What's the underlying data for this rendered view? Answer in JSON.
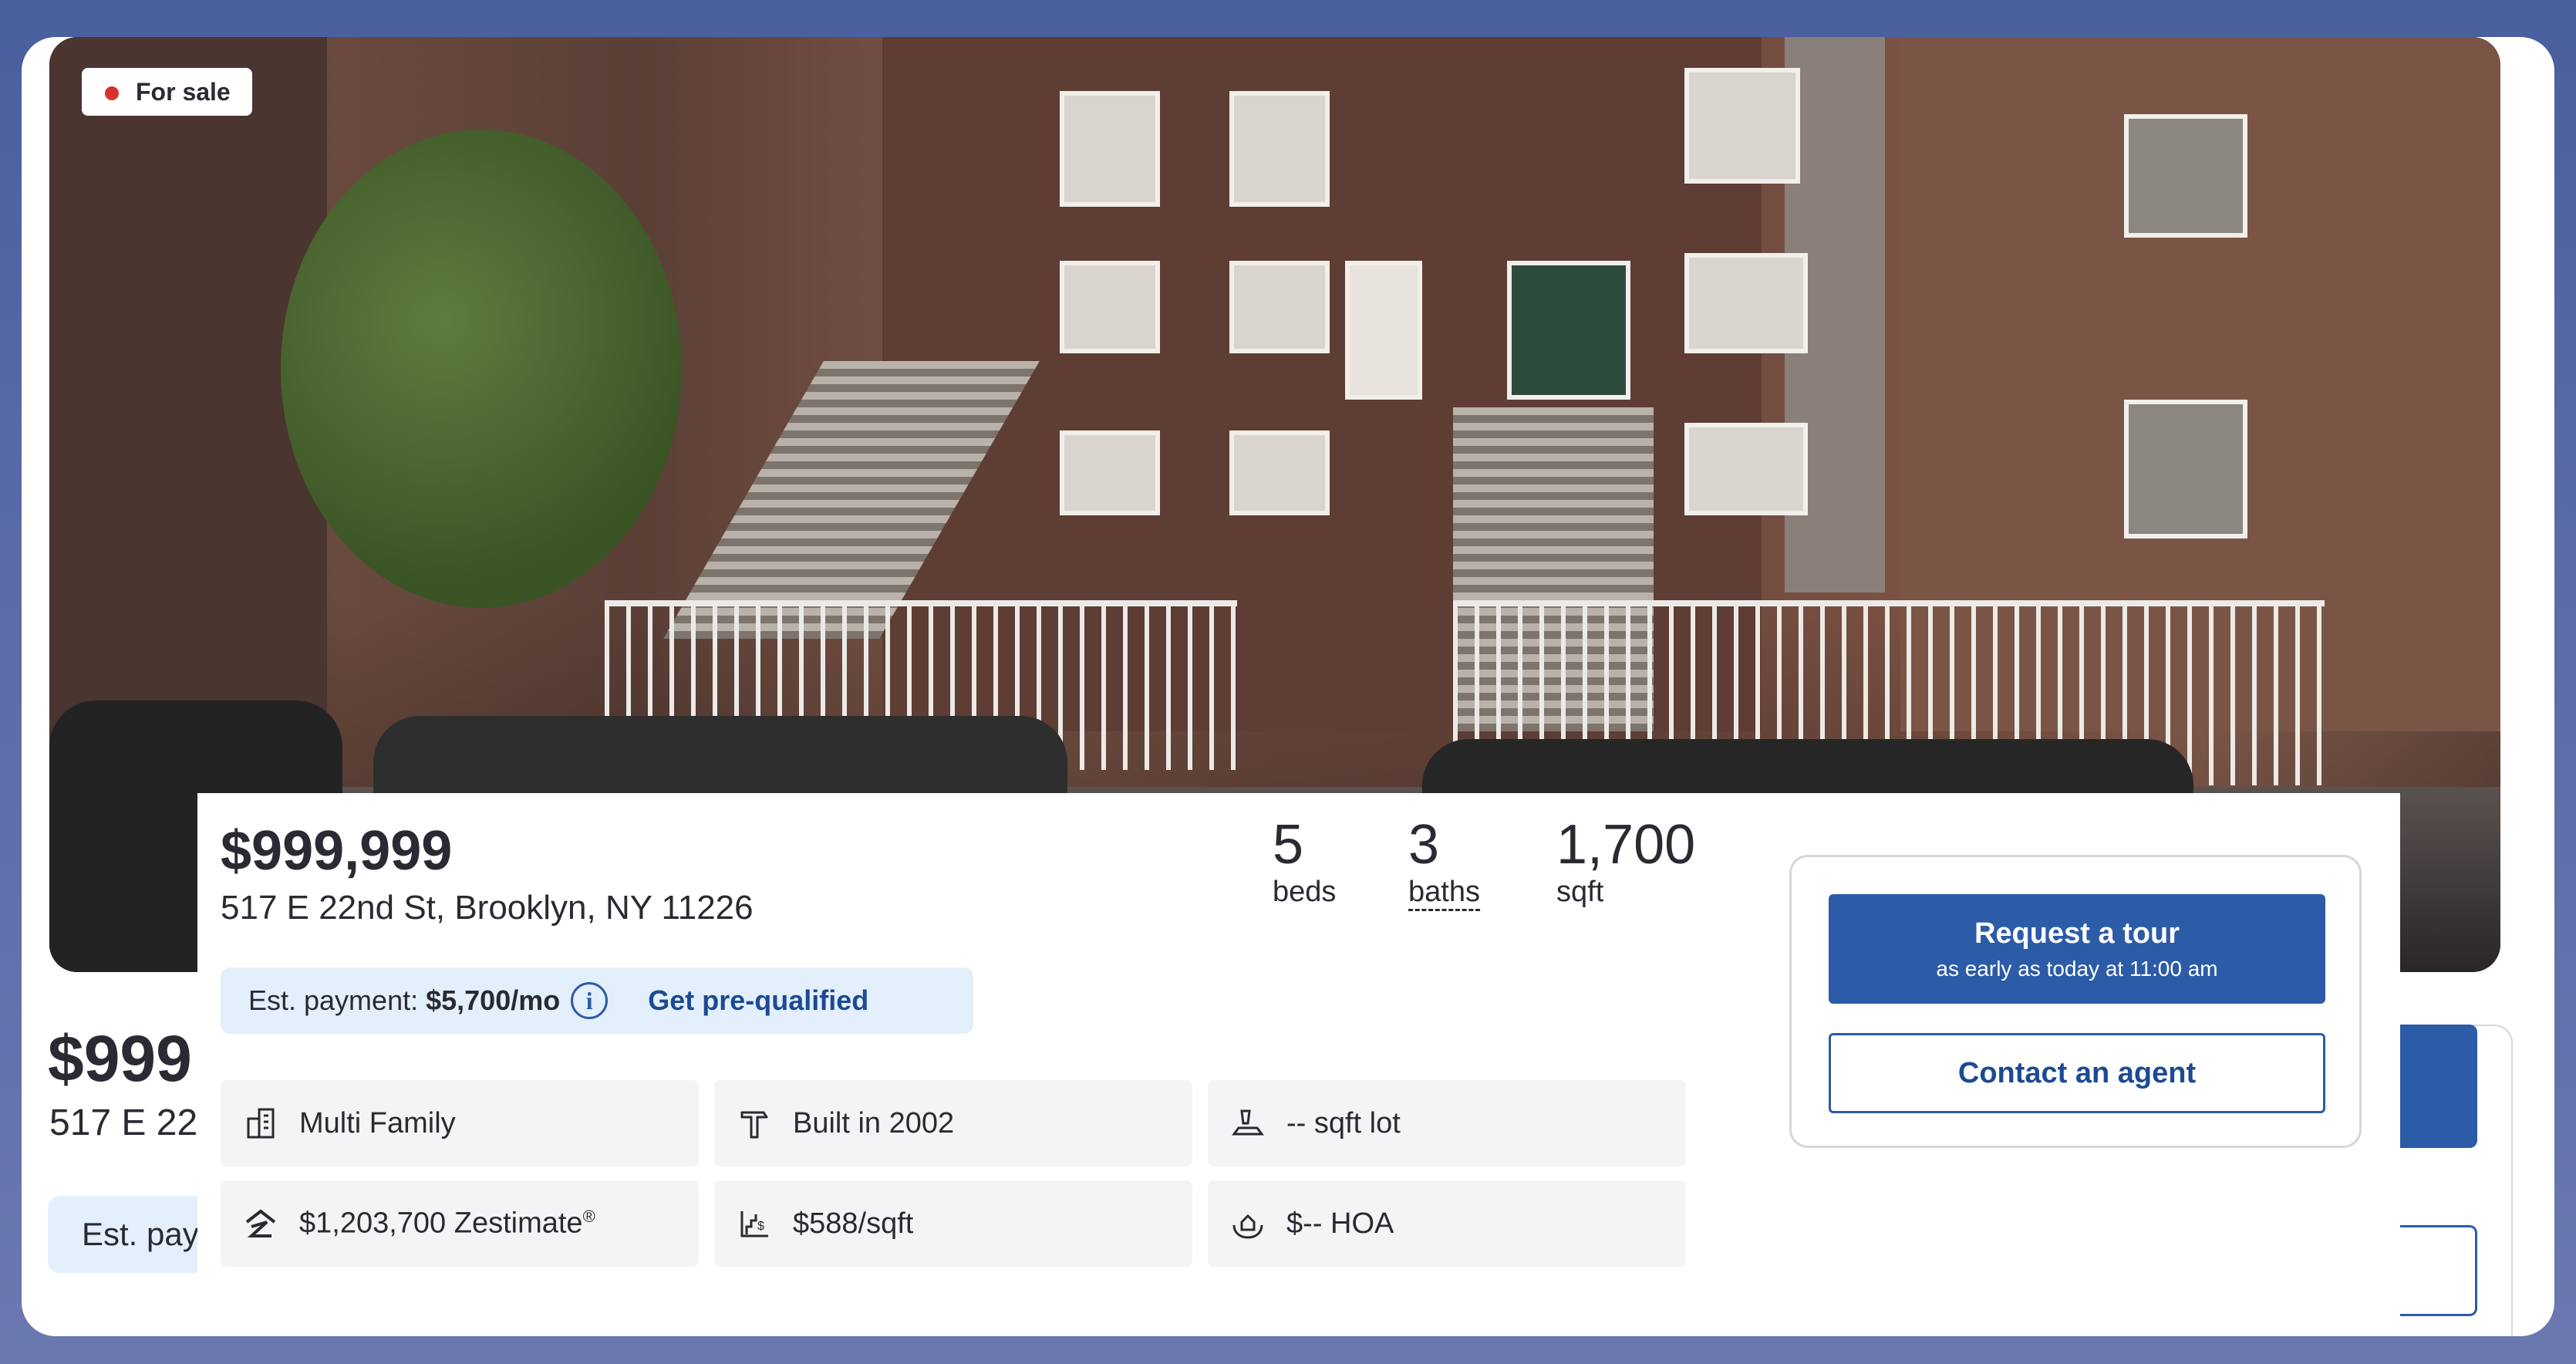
{
  "listing": {
    "status": "For sale",
    "price": "$999,999",
    "address": "517 E 22nd St, Brooklyn, NY 11226",
    "stats": {
      "beds": {
        "value": "5",
        "label": "beds"
      },
      "baths": {
        "value": "3",
        "label": "baths"
      },
      "sqft": {
        "value": "1,700",
        "label": "sqft"
      }
    },
    "payment": {
      "label": "Est. payment:",
      "amount": "$5,700/mo",
      "prequal_label": "Get pre-qualified"
    },
    "facts": [
      {
        "icon": "building-icon",
        "text": "Multi Family"
      },
      {
        "icon": "hammer-icon",
        "text": "Built in 2002"
      },
      {
        "icon": "lot-icon",
        "text": "-- sqft lot"
      },
      {
        "icon": "zestimate-icon",
        "text": "$1,203,700 Zestimate",
        "sup": "®"
      },
      {
        "icon": "price-per-sqft-icon",
        "text": "$588/sqft"
      },
      {
        "icon": "hoa-icon",
        "text": "$-- HOA"
      }
    ]
  },
  "cta": {
    "tour_title": "Request a tour",
    "tour_subtitle": "as early as today at 11:00 am",
    "contact_label": "Contact an agent"
  },
  "background": {
    "price_partial": "$999",
    "address_partial": "517 E 22",
    "est_partial": "Est. pay"
  },
  "colors": {
    "accent": "#2c5ba8",
    "status_dot": "#d8322f",
    "payment_bg": "#e3f0fb"
  }
}
